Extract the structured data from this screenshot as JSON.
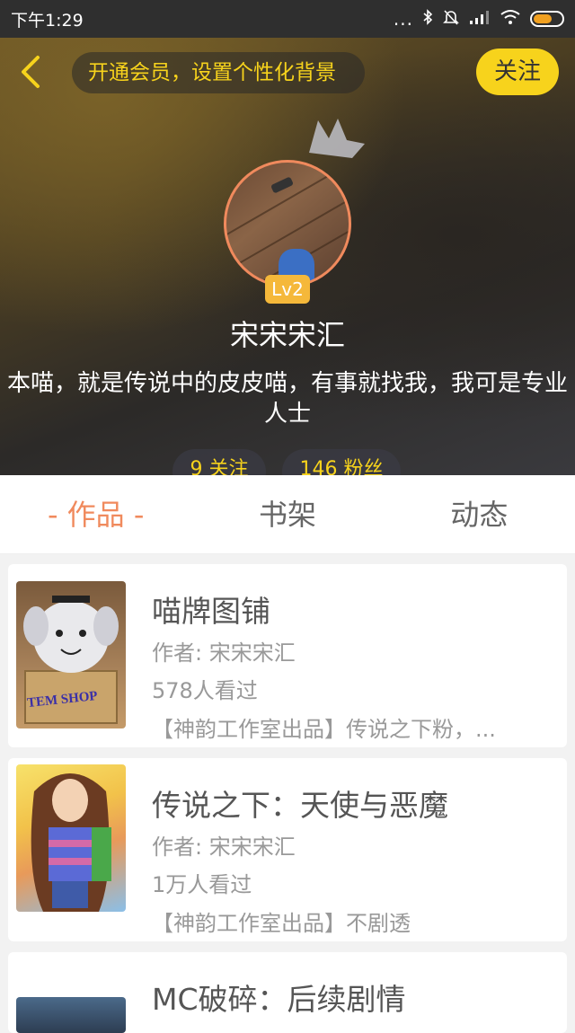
{
  "status_bar": {
    "time": "下午1:29",
    "dots": "...",
    "icons": [
      "bluetooth-icon",
      "mute-icon",
      "signal-icon",
      "wifi-icon",
      "battery-icon"
    ],
    "battery_level": 0.65
  },
  "header": {
    "back_icon": "chevron-left-icon",
    "vip_banner": "开通会员，设置个性化背景",
    "follow_button": "关注",
    "accent_color": "#f7d31c"
  },
  "profile": {
    "level": "Lv2",
    "username": "宋宋宋汇",
    "bio": "本喵，就是传说中的皮皮喵，有事就找我，我可是专业人士",
    "following": "9 关注",
    "fans": "146 粉丝"
  },
  "tabs": [
    {
      "label": "- 作品 -",
      "active": true
    },
    {
      "label": "书架",
      "active": false
    },
    {
      "label": "动态",
      "active": false
    }
  ],
  "works": [
    {
      "title": "喵牌图铺",
      "author": "作者: 宋宋宋汇",
      "views": "578人看过",
      "desc": "【神韵工作室出品】传说之下粉，...",
      "cover_text": "TEM SHOP"
    },
    {
      "title": "传说之下：天使与恶魔",
      "author": "作者: 宋宋宋汇",
      "views": "1万人看过",
      "desc": "【神韵工作室出品】不剧透"
    },
    {
      "title": "MC破碎：后续剧情"
    }
  ]
}
